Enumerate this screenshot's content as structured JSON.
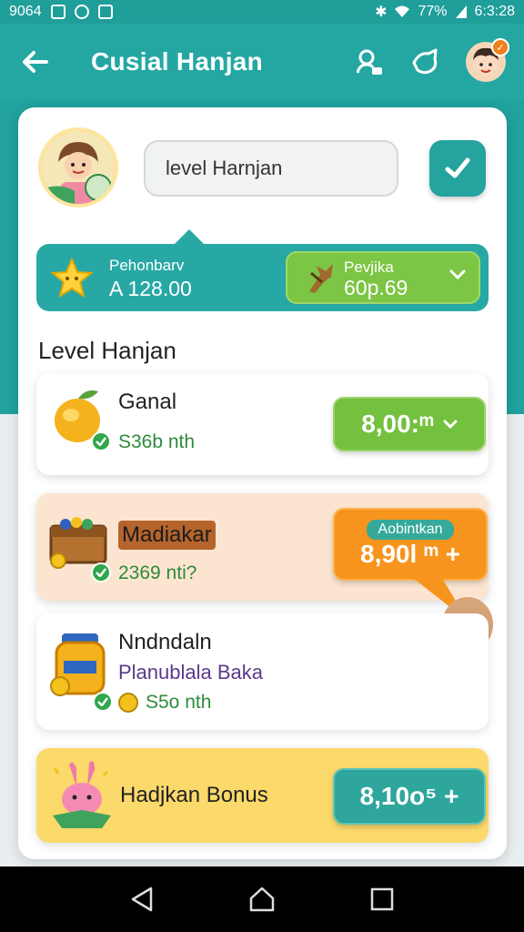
{
  "status_bar": {
    "time_left": "9064",
    "battery": "77%",
    "clock": "6:3:28"
  },
  "appbar": {
    "title": "Cusial Hanjan"
  },
  "profile": {
    "search_value": "level Harnjan"
  },
  "stats": {
    "left_label": "Pehonbarv",
    "left_value": "A 128.00",
    "right_label": "Pevjika",
    "right_value": "60p.69"
  },
  "section": {
    "title": "Level Hanjan"
  },
  "items": [
    {
      "name": "Ganal",
      "meta": "S36b nth",
      "price": "8,00:ᵐ"
    },
    {
      "name": "Madiakar",
      "meta": "2369 nti?",
      "badge": "Aobintkan",
      "price": "8,90l ᵐ +"
    },
    {
      "name": "Nndndaln",
      "subtitle": "Planublala Baka",
      "meta": "S5o nth"
    },
    {
      "name": "Hadjkan Bonus",
      "price": "8,10o⁵ +"
    }
  ],
  "colors": {
    "teal": "#24a7a3",
    "green": "#7cc545",
    "orange": "#f7941d",
    "yellow": "#fbd96a"
  }
}
